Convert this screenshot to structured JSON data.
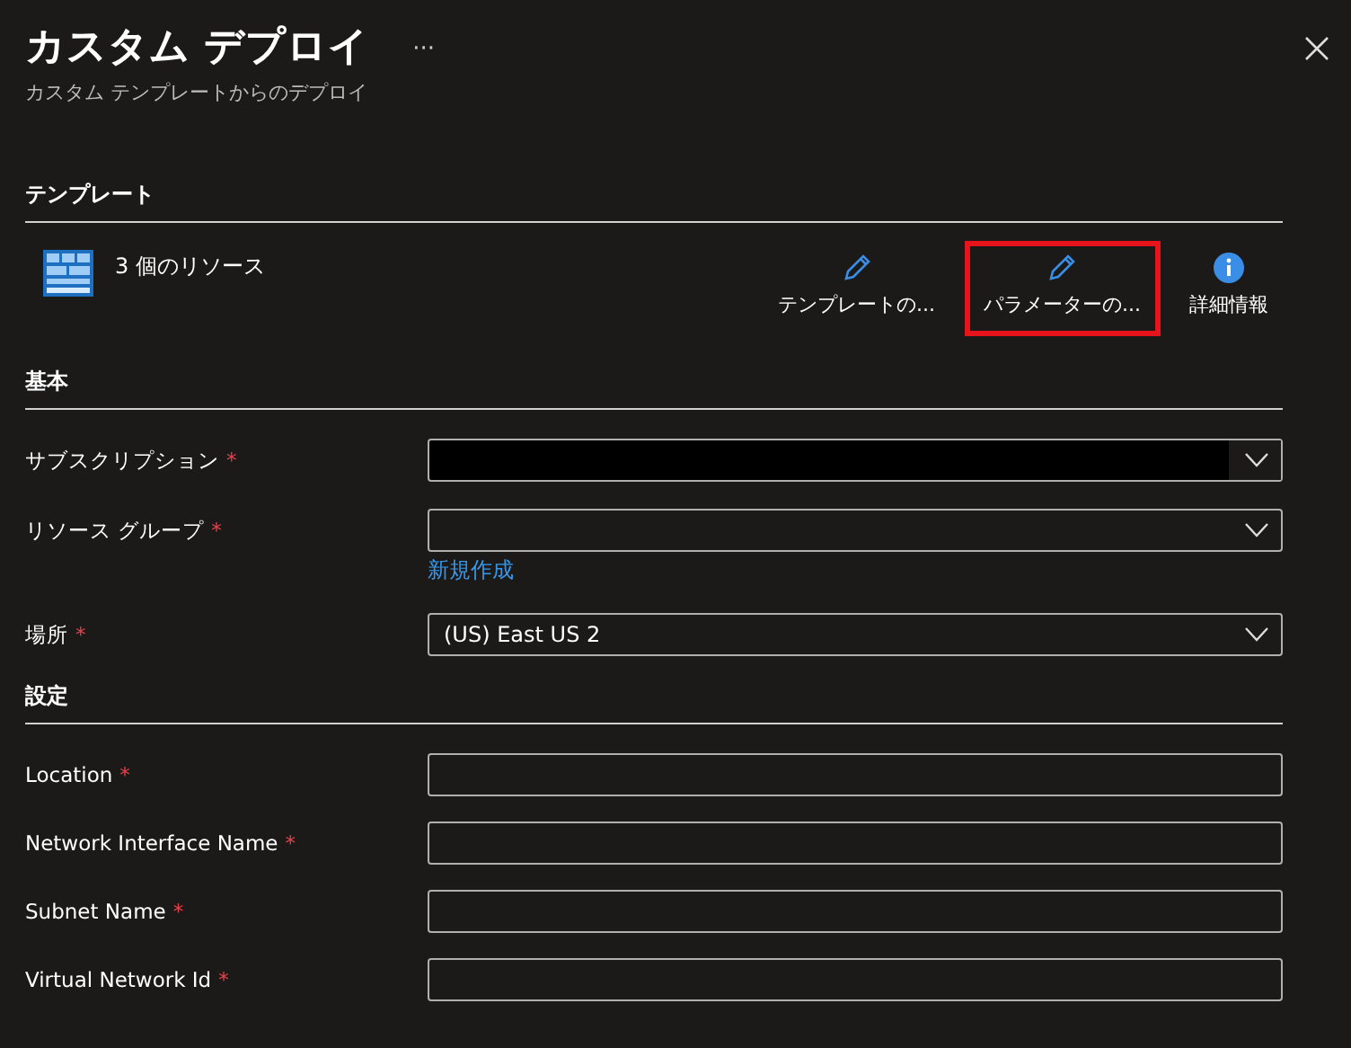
{
  "header": {
    "title": "カスタム デプロイ",
    "more": "···",
    "subtitle": "カスタム テンプレートからのデプロイ"
  },
  "template": {
    "heading": "テンプレート",
    "resources": "3 個のリソース",
    "actions": [
      {
        "kind": "edit",
        "label": "テンプレートの...",
        "highlighted": false
      },
      {
        "kind": "edit",
        "label": "パラメーターの...",
        "highlighted": true
      },
      {
        "kind": "info",
        "label": "詳細情報",
        "highlighted": false
      }
    ]
  },
  "basics": {
    "heading": "基本",
    "fields": [
      {
        "kind": "dropdown",
        "label": "サブスクリプション",
        "required_mark": "*",
        "redacted": true
      },
      {
        "kind": "dropdown",
        "label": "リソース グループ",
        "required_mark": "*",
        "redacted": false,
        "link": "新規作成"
      },
      {
        "kind": "dropdown",
        "label": "場所",
        "required_mark": "*",
        "redacted": false,
        "value": "(US) East US 2"
      }
    ]
  },
  "settings": {
    "heading": "設定",
    "fields": [
      {
        "kind": "text",
        "label": "Location",
        "required_mark": "*"
      },
      {
        "kind": "text",
        "label": "Network Interface Name",
        "required_mark": "*"
      },
      {
        "kind": "text",
        "label": "Subnet Name",
        "required_mark": "*"
      },
      {
        "kind": "text",
        "label": "Virtual Network Id",
        "required_mark": "*"
      }
    ]
  }
}
